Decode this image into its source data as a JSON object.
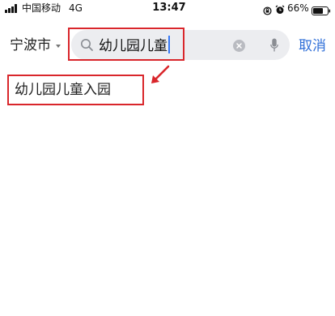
{
  "status_bar": {
    "carrier": "中国移动",
    "network": "4G",
    "time": "13:47",
    "battery_percent": "66%",
    "icons": [
      "signal-icon",
      "lock-rotation-icon",
      "alarm-icon",
      "battery-icon"
    ]
  },
  "header": {
    "city": "宁波市",
    "search": {
      "value": "幼儿园儿童",
      "icons": [
        "search-icon",
        "clear-icon",
        "mic-icon"
      ]
    },
    "cancel_label": "取消"
  },
  "suggestions": [
    {
      "label": "幼儿园儿童入园"
    }
  ],
  "colors": {
    "accent": "#2f6fd8",
    "cursor": "#3478f6",
    "annotation": "#d9262b",
    "search_background": "#ecedf0"
  }
}
